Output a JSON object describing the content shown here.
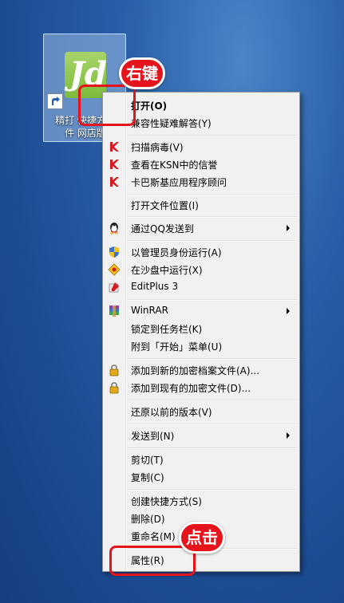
{
  "desktop_icon": {
    "logo_text": "Jd",
    "label_line1": "精打 快捷方式",
    "label_line2": "件 网店版"
  },
  "menu": {
    "items": [
      {
        "label": "打开(O)",
        "bold": true,
        "icon": ""
      },
      {
        "label": "兼容性疑难解答(Y)",
        "icon": ""
      },
      {
        "label": "扫描病毒(V)",
        "icon": "kaspersky-icon"
      },
      {
        "label": "查看在KSN中的信誉",
        "icon": "kaspersky-icon"
      },
      {
        "label": "卡巴斯基应用程序顾问",
        "icon": "kaspersky-icon"
      },
      {
        "label": "打开文件位置(I)",
        "icon": ""
      },
      {
        "label": "通过QQ发送到",
        "icon": "qq-icon",
        "submenu": true
      },
      {
        "label": "以管理员身份运行(A)",
        "icon": "uac-shield-icon"
      },
      {
        "label": "在沙盘中运行(X)",
        "icon": "sandbox-icon"
      },
      {
        "label": "EditPlus 3",
        "icon": "editplus-icon"
      },
      {
        "label": "WinRAR",
        "icon": "winrar-icon",
        "submenu": true
      },
      {
        "label": "锁定到任务栏(K)",
        "icon": ""
      },
      {
        "label": "附到「开始」菜单(U)",
        "icon": ""
      },
      {
        "label": "添加到新的加密档案文件(A)...",
        "icon": "lock-icon"
      },
      {
        "label": "添加到现有的加密文件(D)...",
        "icon": "lock-icon"
      },
      {
        "label": "还原以前的版本(V)",
        "icon": ""
      },
      {
        "label": "发送到(N)",
        "icon": "",
        "submenu": true
      },
      {
        "label": "剪切(T)",
        "icon": ""
      },
      {
        "label": "复制(C)",
        "icon": ""
      },
      {
        "label": "创建快捷方式(S)",
        "icon": ""
      },
      {
        "label": "删除(D)",
        "icon": ""
      },
      {
        "label": "重命名(M)",
        "icon": ""
      },
      {
        "label": "属性(R)",
        "icon": ""
      }
    ]
  },
  "annotations": {
    "right_click_label": "右键",
    "click_label": "点击"
  },
  "colors": {
    "annotation_red": "#e5141c",
    "menu_background": "#f1f1f1"
  }
}
